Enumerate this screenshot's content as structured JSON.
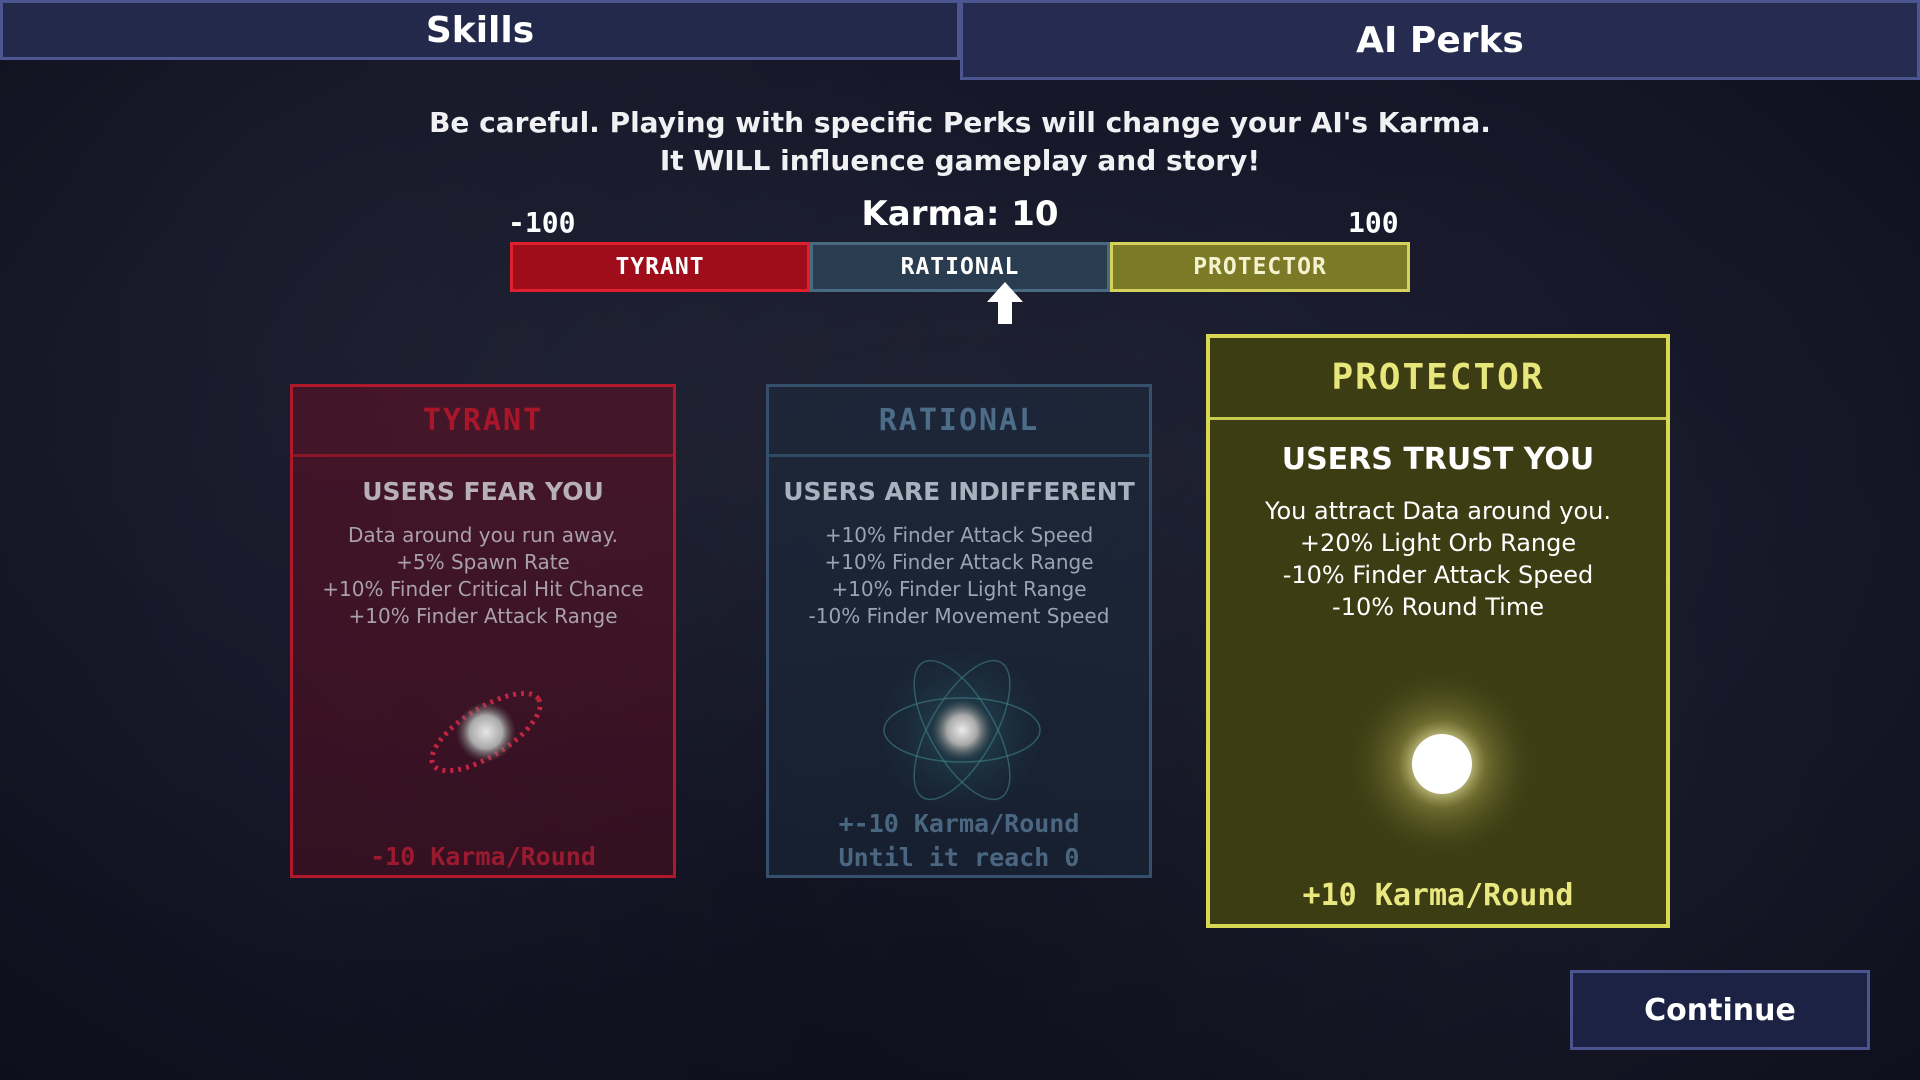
{
  "tabs": {
    "skills": "Skills",
    "ai_perks": "AI Perks"
  },
  "warning": {
    "line1": "Be careful. Playing with specific Perks will change your AI's Karma.",
    "line2": "It WILL influence gameplay and story!"
  },
  "karma": {
    "label": "Karma: 10",
    "value": 10,
    "min": "-100",
    "max": "100",
    "segments": {
      "tyrant": "TYRANT",
      "rational": "RATIONAL",
      "protector": "PROTECTOR"
    }
  },
  "cards": {
    "tyrant": {
      "title": "TYRANT",
      "subtitle": "USERS FEAR YOU",
      "lines": [
        "Data around you run away.",
        "+5% Spawn Rate",
        "+10% Finder Critical Hit Chance",
        "+10% Finder Attack Range"
      ],
      "footer": "-10 Karma/Round"
    },
    "rational": {
      "title": "RATIONAL",
      "subtitle": "USERS ARE INDIFFERENT",
      "lines": [
        "+10% Finder Attack Speed",
        "+10% Finder Attack Range",
        "+10% Finder Light Range",
        "-10% Finder Movement Speed"
      ],
      "footer1": "+-10 Karma/Round",
      "footer2": "Until it reach 0"
    },
    "protector": {
      "title": "PROTECTOR",
      "subtitle": "USERS TRUST YOU",
      "lines": [
        "You attract Data around you.",
        "+20% Light Orb Range",
        "-10% Finder Attack Speed",
        "-10% Round Time"
      ],
      "footer": "+10 Karma/Round",
      "selected": true
    }
  },
  "continue_label": "Continue",
  "colors": {
    "tyrant": "#b0182c",
    "rational": "#34506a",
    "protector": "#d8d854",
    "tab_bg": "#23294a"
  },
  "icons": {
    "pointer": "up-arrow-icon",
    "tyrant_orb": "tyrant-orb-icon",
    "rational_orb": "rational-orb-icon",
    "protector_orb": "protector-orb-icon"
  }
}
